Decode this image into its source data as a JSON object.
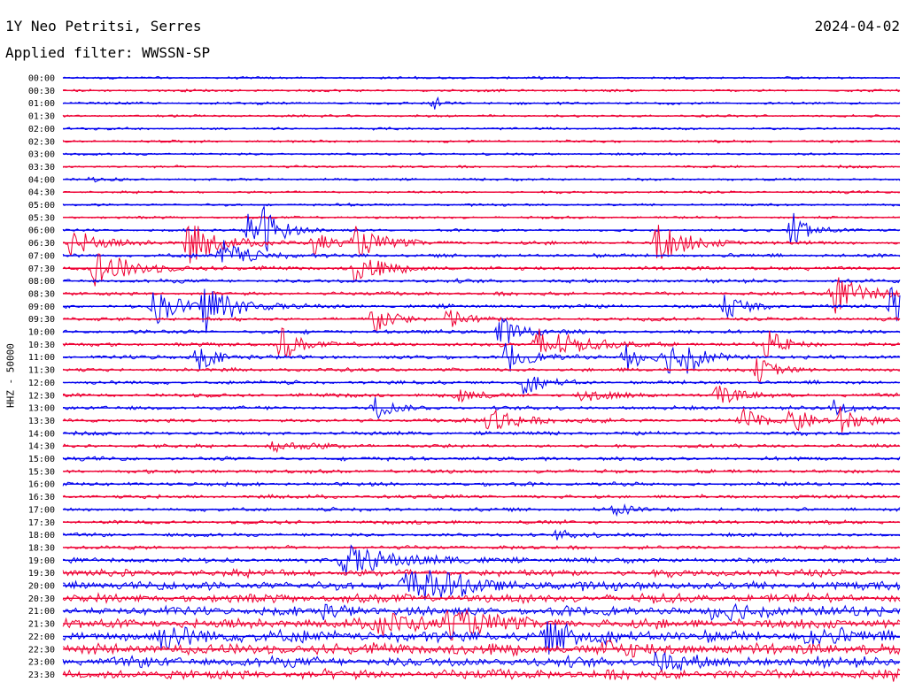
{
  "header": {
    "station": "1Y Neo Petritsi, Serres",
    "date": "2024-04-02",
    "filter": "Applied filter: WWSSN-SP",
    "channel_label": "HHZ - 50000"
  },
  "colors": {
    "even": "#0000ee",
    "odd": "#ee0033"
  },
  "chart_data": {
    "type": "line",
    "title": "1Y Neo Petritsi, Serres",
    "ylabel": "HHZ - 50000",
    "xlabel": "",
    "trace_labels": [
      "00:00",
      "00:30",
      "01:00",
      "01:30",
      "02:00",
      "02:30",
      "03:00",
      "03:30",
      "04:00",
      "04:30",
      "05:00",
      "05:30",
      "06:00",
      "06:30",
      "07:00",
      "07:30",
      "08:00",
      "08:30",
      "09:00",
      "09:30",
      "10:00",
      "10:30",
      "11:00",
      "11:30",
      "12:00",
      "12:30",
      "13:00",
      "13:30",
      "14:00",
      "14:30",
      "15:00",
      "15:30",
      "16:00",
      "16:30",
      "17:00",
      "17:30",
      "18:00",
      "18:30",
      "19:00",
      "19:30",
      "20:00",
      "20:30",
      "21:00",
      "21:30",
      "22:00",
      "22:30",
      "23:00",
      "23:30"
    ],
    "noise_level": [
      1,
      1,
      1,
      1,
      1,
      1,
      1,
      1,
      1,
      1,
      1,
      1,
      1,
      1.5,
      1.5,
      1.5,
      1.5,
      1.5,
      1.5,
      1.5,
      1.5,
      1.5,
      1.5,
      1.5,
      1.5,
      1.5,
      1.5,
      1.5,
      1.5,
      1.5,
      1.5,
      1.5,
      1.5,
      1.5,
      1.5,
      1.5,
      1.5,
      1.5,
      2,
      3,
      3.5,
      3.5,
      3.5,
      4,
      4.5,
      4.5,
      4,
      4
    ],
    "events": [
      {
        "trace": 2,
        "x": 0.44,
        "amp": 12,
        "dur": 0.01
      },
      {
        "trace": 8,
        "x": 0.03,
        "amp": 2,
        "dur": 0.03
      },
      {
        "trace": 12,
        "x": 0.24,
        "amp": 22,
        "dur": 0.02
      },
      {
        "trace": 12,
        "x": 0.22,
        "amp": 20,
        "dur": 0.02
      },
      {
        "trace": 12,
        "x": 0.87,
        "amp": 24,
        "dur": 0.02
      },
      {
        "trace": 13,
        "x": 0.01,
        "amp": 16,
        "dur": 0.03
      },
      {
        "trace": 13,
        "x": 0.15,
        "amp": 26,
        "dur": 0.03
      },
      {
        "trace": 13,
        "x": 0.3,
        "amp": 14,
        "dur": 0.02
      },
      {
        "trace": 13,
        "x": 0.35,
        "amp": 16,
        "dur": 0.03
      },
      {
        "trace": 13,
        "x": 0.71,
        "amp": 24,
        "dur": 0.03
      },
      {
        "trace": 14,
        "x": 0.19,
        "amp": 18,
        "dur": 0.03
      },
      {
        "trace": 15,
        "x": 0.35,
        "amp": 18,
        "dur": 0.03
      },
      {
        "trace": 15,
        "x": 0.04,
        "amp": 20,
        "dur": 0.04
      },
      {
        "trace": 17,
        "x": 0.92,
        "amp": 24,
        "dur": 0.03
      },
      {
        "trace": 18,
        "x": 0.11,
        "amp": 20,
        "dur": 0.03
      },
      {
        "trace": 18,
        "x": 0.17,
        "amp": 30,
        "dur": 0.03
      },
      {
        "trace": 18,
        "x": 0.79,
        "amp": 18,
        "dur": 0.02
      },
      {
        "trace": 18,
        "x": 0.99,
        "amp": 24,
        "dur": 0.02
      },
      {
        "trace": 19,
        "x": 0.37,
        "amp": 20,
        "dur": 0.02
      },
      {
        "trace": 19,
        "x": 0.46,
        "amp": 14,
        "dur": 0.02
      },
      {
        "trace": 20,
        "x": 0.52,
        "amp": 22,
        "dur": 0.02
      },
      {
        "trace": 21,
        "x": 0.26,
        "amp": 22,
        "dur": 0.02
      },
      {
        "trace": 21,
        "x": 0.57,
        "amp": 22,
        "dur": 0.04
      },
      {
        "trace": 21,
        "x": 0.84,
        "amp": 18,
        "dur": 0.02
      },
      {
        "trace": 22,
        "x": 0.16,
        "amp": 18,
        "dur": 0.02
      },
      {
        "trace": 22,
        "x": 0.53,
        "amp": 20,
        "dur": 0.02
      },
      {
        "trace": 22,
        "x": 0.67,
        "amp": 20,
        "dur": 0.02
      },
      {
        "trace": 22,
        "x": 0.72,
        "amp": 20,
        "dur": 0.02
      },
      {
        "trace": 22,
        "x": 0.74,
        "amp": 18,
        "dur": 0.02
      },
      {
        "trace": 23,
        "x": 0.83,
        "amp": 14,
        "dur": 0.02
      },
      {
        "trace": 24,
        "x": 0.55,
        "amp": 14,
        "dur": 0.02
      },
      {
        "trace": 25,
        "x": 0.47,
        "amp": 10,
        "dur": 0.02
      },
      {
        "trace": 25,
        "x": 0.62,
        "amp": 8,
        "dur": 0.03
      },
      {
        "trace": 25,
        "x": 0.78,
        "amp": 14,
        "dur": 0.02
      },
      {
        "trace": 26,
        "x": 0.37,
        "amp": 14,
        "dur": 0.02
      },
      {
        "trace": 26,
        "x": 0.92,
        "amp": 12,
        "dur": 0.02
      },
      {
        "trace": 27,
        "x": 0.51,
        "amp": 18,
        "dur": 0.03
      },
      {
        "trace": 27,
        "x": 0.81,
        "amp": 16,
        "dur": 0.02
      },
      {
        "trace": 27,
        "x": 0.87,
        "amp": 18,
        "dur": 0.02
      },
      {
        "trace": 27,
        "x": 0.93,
        "amp": 16,
        "dur": 0.02
      },
      {
        "trace": 29,
        "x": 0.25,
        "amp": 5,
        "dur": 0.05
      },
      {
        "trace": 34,
        "x": 0.66,
        "amp": 8,
        "dur": 0.02
      },
      {
        "trace": 36,
        "x": 0.59,
        "amp": 6,
        "dur": 0.02
      },
      {
        "trace": 38,
        "x": 0.34,
        "amp": 16,
        "dur": 0.06
      },
      {
        "trace": 40,
        "x": 0.41,
        "amp": 18,
        "dur": 0.04
      },
      {
        "trace": 40,
        "x": 0.44,
        "amp": 8,
        "dur": 0.04
      },
      {
        "trace": 42,
        "x": 0.31,
        "amp": 6,
        "dur": 0.03
      },
      {
        "trace": 42,
        "x": 0.78,
        "amp": 8,
        "dur": 0.06
      },
      {
        "trace": 43,
        "x": 0.38,
        "amp": 12,
        "dur": 0.04
      },
      {
        "trace": 43,
        "x": 0.46,
        "amp": 16,
        "dur": 0.04
      },
      {
        "trace": 44,
        "x": 0.12,
        "amp": 10,
        "dur": 0.05
      },
      {
        "trace": 44,
        "x": 0.58,
        "amp": 14,
        "dur": 0.04
      },
      {
        "trace": 44,
        "x": 0.89,
        "amp": 10,
        "dur": 0.03
      },
      {
        "trace": 45,
        "x": 0.65,
        "amp": 8,
        "dur": 0.03
      },
      {
        "trace": 46,
        "x": 0.71,
        "amp": 10,
        "dur": 0.03
      },
      {
        "trace": 47,
        "x": 0.99,
        "amp": 12,
        "dur": 0.01
      }
    ]
  }
}
